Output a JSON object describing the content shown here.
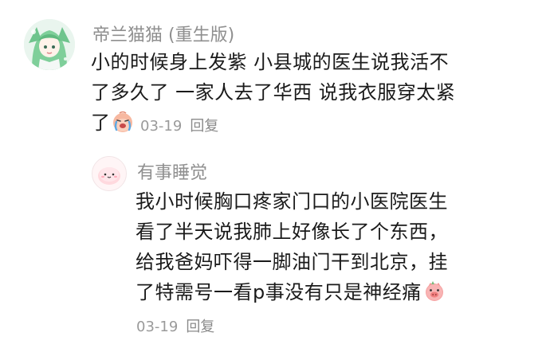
{
  "comments": [
    {
      "username": "帝兰猫猫 (重生版)",
      "avatar_icon": "anime-girl-avatar",
      "text_lines": [
        "小的时候身上发紫 小县城的医生说我活不",
        "了多久了 一家人去了华西 说我衣服穿太紧",
        "了"
      ],
      "inline_emoji": "crying-face-icon",
      "date": "03-19",
      "reply_label": "回复"
    },
    {
      "username": "有事睡觉",
      "avatar_icon": "pink-bun-avatar",
      "text_lines": [
        "我小时候胸口疼家门口的小医院医生",
        "看了半天说我肺上好像长了个东西，",
        "给我爸妈吓得一脚油门干到北京，挂",
        "了特需号一看p事没有只是神经痛"
      ],
      "inline_emoji": "pig-face-icon",
      "date": "03-19",
      "reply_label": "回复"
    }
  ],
  "colors": {
    "username": "#8f8f8f",
    "text": "#1a1a1a",
    "meta": "#9a9a9a"
  }
}
